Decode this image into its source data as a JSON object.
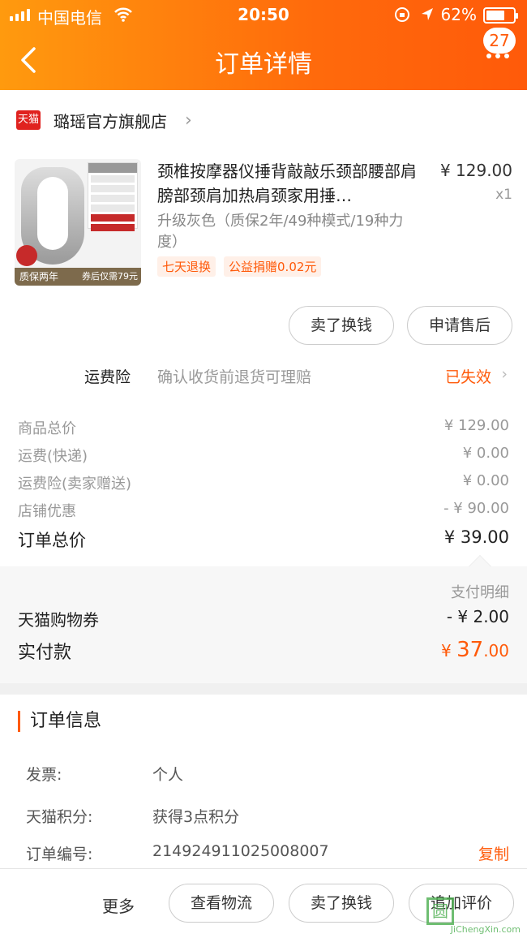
{
  "status_bar": {
    "carrier": "中国电信",
    "time": "20:50",
    "battery": "62%"
  },
  "nav": {
    "title": "订单详情",
    "badge": "27"
  },
  "shop": {
    "logo_text": "天猫",
    "name": "璐瑶官方旗舰店"
  },
  "product": {
    "title": "颈椎按摩器仪捶背敲敲乐颈部腰部肩膀部颈肩加热肩颈家用捶…",
    "price": "¥ 129.00",
    "qty": "x1",
    "sku": "升级灰色（质保2年/49种模式/19种力度）",
    "tags": [
      "七天退换",
      "公益捐赠0.02元"
    ],
    "thumb_bar_left": "质保两年",
    "thumb_bar_right": "券后仅需79元"
  },
  "item_buttons": {
    "sell": "卖了换钱",
    "after_sale": "申请售后"
  },
  "insurance": {
    "label": "运费险",
    "desc": "确认收货前退货可理赔",
    "state": "已失效"
  },
  "summary": [
    {
      "label": "商品总价",
      "value": "¥ 129.00"
    },
    {
      "label": "运费(快递)",
      "value": "¥ 0.00"
    },
    {
      "label": "运费险(卖家赠送)",
      "value": "¥ 0.00"
    },
    {
      "label": "店铺优惠",
      "value": "- ¥ 90.00"
    }
  ],
  "order_total": {
    "label": "订单总价",
    "value": "¥ 39.00"
  },
  "payment": {
    "detail_label": "支付明细",
    "coupon_label": "天猫购物券",
    "coupon_value": "- ¥ 2.00",
    "paid_label": "实付款",
    "paid_currency": "¥",
    "paid_int": "37",
    "paid_dec": ".00"
  },
  "order_info": {
    "title": "订单信息",
    "invoice_label": "发票:",
    "invoice_value": "个人",
    "points_label": "天猫积分:",
    "points_value": "获得3点积分",
    "number_label": "订单编号:",
    "number_value": "214924911025008007",
    "copy_label": "复制"
  },
  "footer": {
    "more": "更多",
    "logistics": "查看物流",
    "sell": "卖了换钱",
    "review": "追加评价"
  },
  "watermark": {
    "logo": "圆",
    "text": "JiChengXin.com"
  }
}
